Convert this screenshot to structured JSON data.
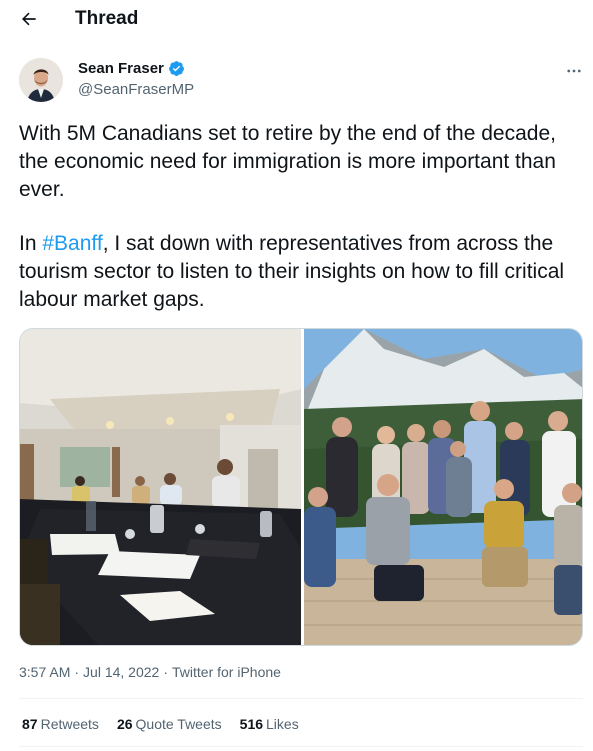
{
  "header": {
    "title": "Thread"
  },
  "author": {
    "name": "Sean Fraser",
    "handle": "@SeanFraserMP"
  },
  "tweet": {
    "para1": "With 5M Canadians set to retire by the end of the decade, the economic need for immigration is more important than ever.",
    "para2_prefix": "In ",
    "hashtag": "#Banff",
    "para2_suffix": ", I sat down with representatives from across the tourism sector to listen to their insights on how to fill critical labour market gaps."
  },
  "meta": {
    "time": "3:57 AM",
    "sep1": "·",
    "date": "Jul 14, 2022",
    "sep2": "·",
    "source": "Twitter for iPhone"
  },
  "stats": {
    "retweets_count": "87",
    "retweets_label": "Retweets",
    "quotes_count": "26",
    "quotes_label": "Quote Tweets",
    "likes_count": "516",
    "likes_label": "Likes"
  },
  "colors": {
    "accent": "#1d9bf0",
    "text": "#0f1419",
    "secondary": "#536471",
    "border": "#eff3f4"
  },
  "icons": {
    "back": "arrow-left-icon",
    "verified": "verified-badge-icon",
    "more": "more-horizontal-icon"
  }
}
